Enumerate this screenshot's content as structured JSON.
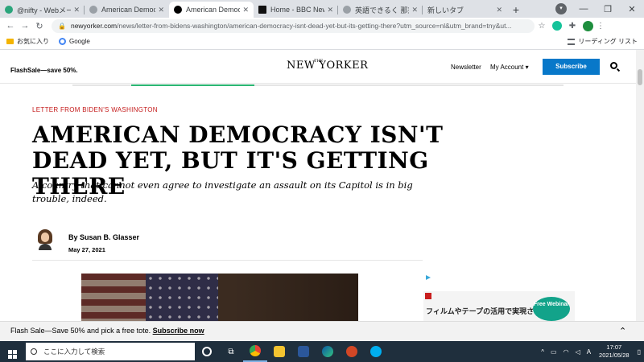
{
  "browser": {
    "tabs": [
      {
        "label": "@nifty - Webメール",
        "color": "#2ba57c",
        "active": false
      },
      {
        "label": "American Democra",
        "color": "#5f6368",
        "active": false
      },
      {
        "label": "American Democra",
        "color": "#000000",
        "active": true
      },
      {
        "label": "Home - BBC News",
        "color": "#111111",
        "active": false
      },
      {
        "label": "英語できるく 那須省",
        "color": "#5f6368",
        "active": false
      },
      {
        "label": "新しいタブ",
        "color": "#ffffff",
        "active": false
      }
    ],
    "url_host": "newyorker.com",
    "url_path": "/news/letter-from-bidens-washington/american-democracy-isnt-dead-yet-but-its-getting-there?utm_source=nl&utm_brand=tny&ut...",
    "bookmarks": {
      "folder": "お気に入り",
      "google": "Google",
      "reading_list": "リーディング リスト"
    }
  },
  "site": {
    "flash_sale": "FlashSale—save 50%.",
    "logo": "NEW YORKER",
    "logo_the": "THE",
    "newsletter": "Newsletter",
    "account": "My Account",
    "subscribe": "Subscribe",
    "reading_progress": 0.25
  },
  "article": {
    "rubric": "LETTER FROM BIDEN'S WASHINGTON",
    "headline": "AMERICAN DEMOCRACY ISN'T DEAD YET, BUT IT'S GETTING THERE",
    "dek": "A country that cannot even agree to investigate an assault on its Capitol is in big trouble, indeed.",
    "byline": "By Susan B. Glasser",
    "date": "May 27, 2021"
  },
  "ad": {
    "text": "フィルムやテープの活用で実現させる、",
    "badge": "Free Webinar"
  },
  "promo": {
    "text": "Flash Sale—Save 50% and pick a free tote.",
    "link": "Subscribe now"
  },
  "taskbar": {
    "search_placeholder": "ここに入力して検索",
    "time": "17:07",
    "date": "2021/05/28",
    "ime": "A"
  }
}
